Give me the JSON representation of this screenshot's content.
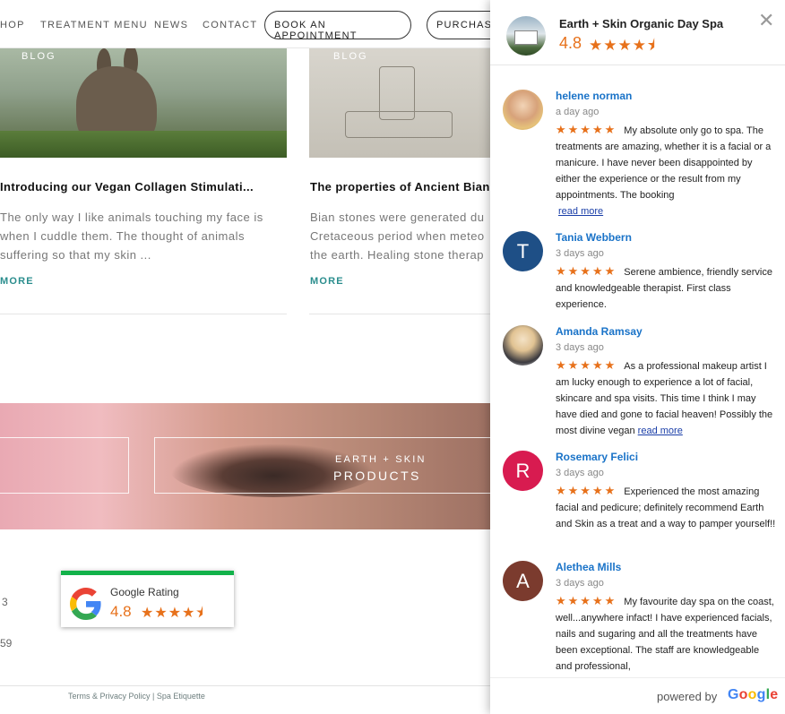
{
  "nav": {
    "items": [
      "HOP",
      "TREATMENT MENU",
      "NEWS",
      "CONTACT"
    ],
    "book_button": "BOOK AN APPOINTMENT",
    "purchase_button": "PURCHASE"
  },
  "cards": [
    {
      "tag": "BLOG",
      "title": "Introducing our Vegan Collagen Stimulati...",
      "excerpt": [
        "The only way I like animals touching my face is",
        "when I cuddle them. The thought of animals",
        "suffering so that my skin ..."
      ],
      "more": "MORE"
    },
    {
      "tag": "BLOG",
      "title": "The properties of Ancient Bian Stone",
      "excerpt": [
        "Bian stones were generated du",
        "Cretaceous period when meteo",
        "the earth. Healing stone therap"
      ],
      "more": "MORE"
    }
  ],
  "banner": {
    "subtitle": "EARTH + SKIN",
    "title": "PRODUCTS"
  },
  "footer": {
    "fragment_1": "3",
    "fragment_2": "59",
    "links": "Terms & Privacy Policy | Spa Etiquette"
  },
  "google_badge": {
    "label": "Google Rating",
    "score": "4.8",
    "stars": "★★★★⯨"
  },
  "reviews_panel": {
    "business_name": "Earth + Skin Organic Day Spa",
    "score": "4.8",
    "stars": "★★★★⯨",
    "close": "✕",
    "reviews": [
      {
        "name": "helene norman",
        "date": "a day ago",
        "stars": "★★★★★",
        "text": "My absolute only go to spa. The treatments are amazing, whether it is a facial or a manicure. I have never been disappointed by either the experience or the result from my appointments. The booking",
        "more": "read more",
        "avatar_color": "#d7a27a"
      },
      {
        "name": "Tania Webbern",
        "date": "3 days ago",
        "stars": "★★★★★",
        "text": "Serene ambience, friendly service and knowledgeable therapist. First class experience.",
        "initial": "T",
        "avatar_color": "#1e4f86"
      },
      {
        "name": "Amanda Ramsay",
        "date": "3 days ago",
        "stars": "★★★★★",
        "text": "As a professional makeup artist I am lucky enough to experience a lot of facial, skincare and spa visits. This time I think I may have died and gone to facial heaven! Possibly the most divine vegan",
        "more": "read more",
        "avatar_color": "#c9b79a"
      },
      {
        "name": "Rosemary Felici",
        "date": "3 days ago",
        "stars": "★★★★★",
        "text": "Experienced the most amazing facial and pedicure; definitely recommend Earth and Skin as a treat and a way to pamper yourself!!",
        "initial": "R",
        "avatar_color": "#d81b50"
      },
      {
        "name": "Alethea Mills",
        "date": "3 days ago",
        "stars": "★★★★★",
        "text": "My favourite day spa on the coast, well...anywhere infact! I have experienced facials, nails and sugaring and all the treatments have been exceptional. The staff are knowledgeable and professional,",
        "initial": "A",
        "avatar_color": "#7b3b2e"
      }
    ],
    "powered_by": "powered by",
    "google_word": "Google"
  }
}
